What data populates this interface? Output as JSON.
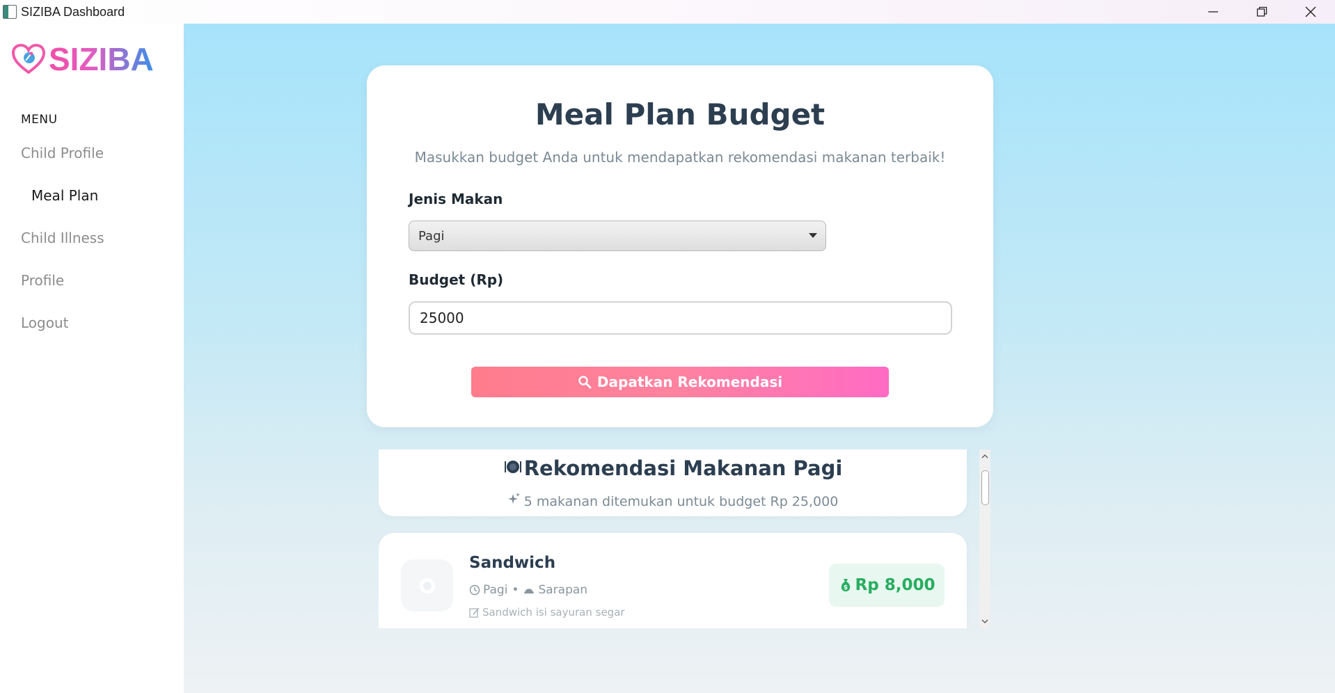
{
  "window": {
    "title": "SIZIBA Dashboard"
  },
  "sidebar": {
    "logo_text": "SIZIBA",
    "menu_heading": "MENU",
    "items": [
      {
        "label": "Child Profile",
        "active": false
      },
      {
        "label": "Meal Plan",
        "active": true
      },
      {
        "label": "Child Illness",
        "active": false
      },
      {
        "label": "Profile",
        "active": false
      },
      {
        "label": "Logout",
        "active": false
      }
    ]
  },
  "form": {
    "title": "Meal Plan Budget",
    "subtitle": "Masukkan budget Anda untuk mendapatkan rekomendasi makanan terbaik!",
    "meal_type_label": "Jenis Makan",
    "meal_type_value": "Pagi",
    "budget_label": "Budget (Rp)",
    "budget_value": "25000",
    "submit_label": "Dapatkan Rekomendasi"
  },
  "results": {
    "title_icon": "plate-icon",
    "title": "Rekomendasi Makanan Pagi",
    "summary": "5 makanan ditemukan untuk budget Rp 25,000",
    "items": [
      {
        "name": "Sandwich",
        "time": "Pagi",
        "category": "Sarapan",
        "description": "Sandwich isi sayuran segar",
        "price": "Rp 8,000"
      }
    ]
  },
  "colors": {
    "accent_pink": "#ff6bc4",
    "accent_coral": "#ff7c8c",
    "price_green": "#27ae60",
    "title_dark": "#2c3e50"
  }
}
